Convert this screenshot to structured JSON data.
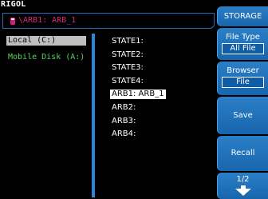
{
  "brand": "RIGOL",
  "path": "\\ARB1:  ARB_1",
  "drives": [
    {
      "label": "Local (C:)",
      "selected": true
    },
    {
      "label": "Mobile Disk (A:)",
      "selected": false
    }
  ],
  "files": [
    {
      "label": "STATE1:",
      "selected": false
    },
    {
      "label": "STATE2:",
      "selected": false
    },
    {
      "label": "STATE3:",
      "selected": false
    },
    {
      "label": "STATE4:",
      "selected": false
    },
    {
      "label": "ARB1:  ARB_1",
      "selected": true
    },
    {
      "label": "ARB2:",
      "selected": false
    },
    {
      "label": "ARB3:",
      "selected": false
    },
    {
      "label": "ARB4:",
      "selected": false
    }
  ],
  "softkeys": {
    "storage": "STORAGE",
    "file_type": {
      "title": "File Type",
      "value": "All File"
    },
    "browser": {
      "title": "Browser",
      "value": "File"
    },
    "save": "Save",
    "recall": "Recall",
    "page": "1/2"
  },
  "colors": {
    "accent": "#1f76c2",
    "path_text": "#d6297f",
    "drive_text": "#5fd15f"
  }
}
